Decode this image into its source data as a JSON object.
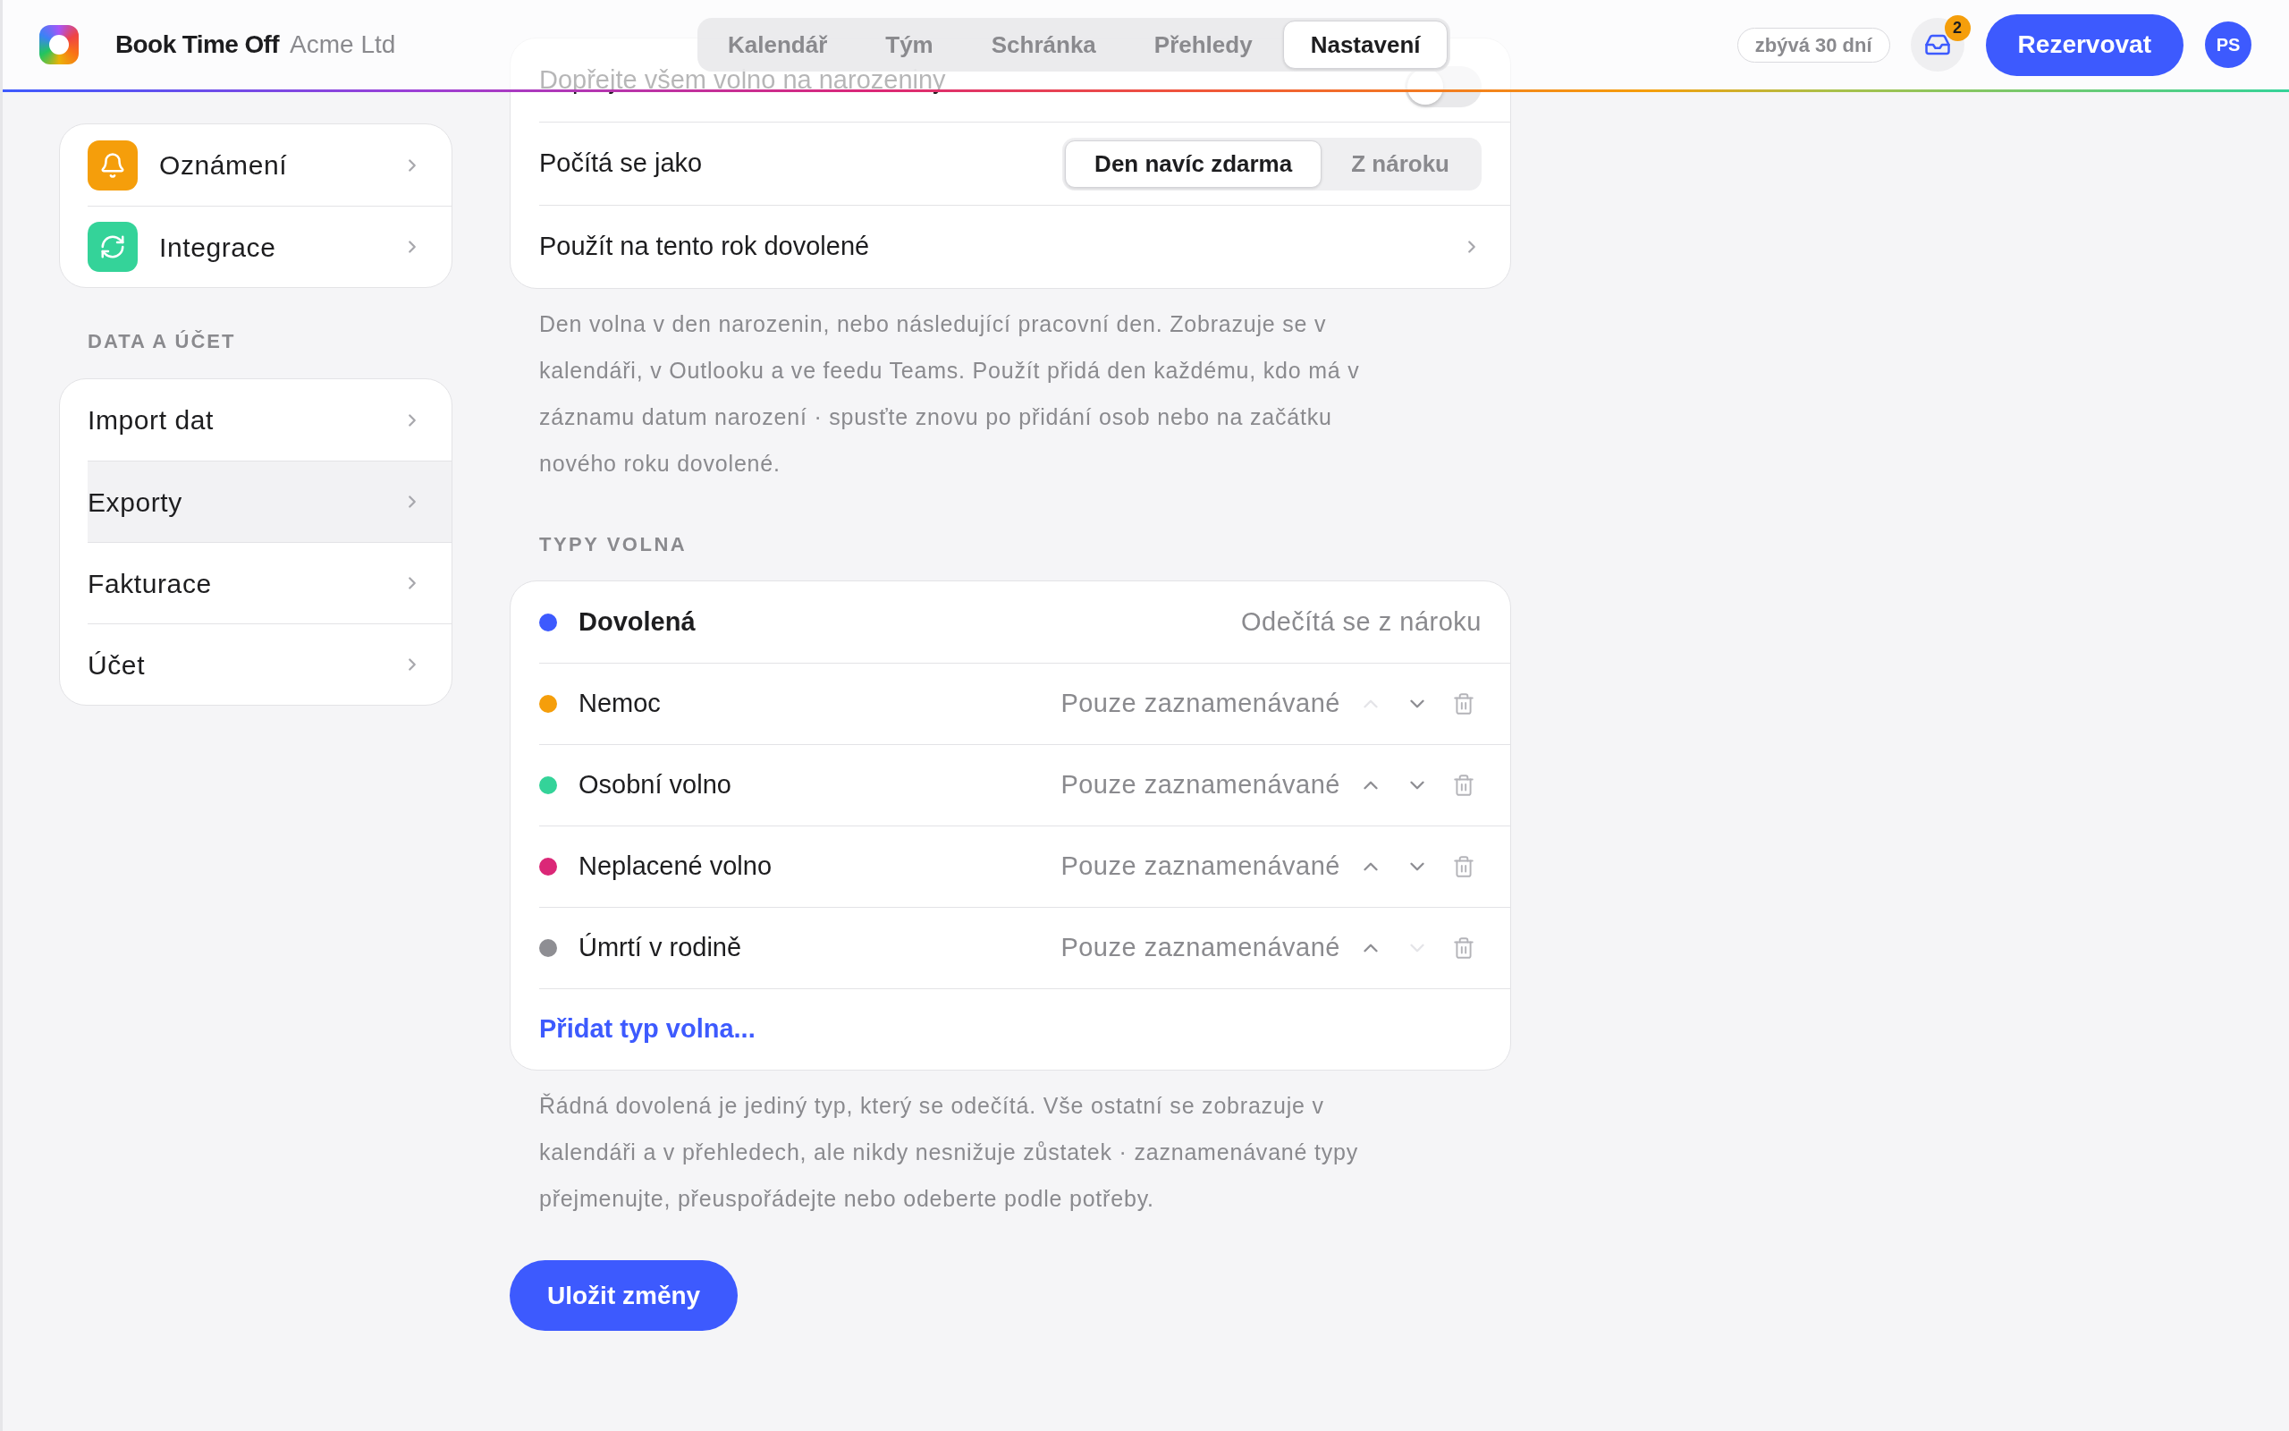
{
  "header": {
    "app_name": "Book Time Off",
    "org": "Acme Ltd",
    "tabs": [
      {
        "label": "Kalendář",
        "selected": false
      },
      {
        "label": "Tým",
        "selected": false
      },
      {
        "label": "Schránka",
        "selected": false
      },
      {
        "label": "Přehledy",
        "selected": false
      },
      {
        "label": "Nastavení",
        "selected": true
      }
    ],
    "remaining": "zbývá 30 dní",
    "inbox_badge": "2",
    "book_button": "Rezervovat",
    "avatar": "PS"
  },
  "sidebar": {
    "groups": [
      {
        "items": [
          {
            "label": "Oznámení",
            "color": "#f59e0b",
            "selected": false
          },
          {
            "label": "Integrace",
            "color": "#34d399",
            "selected": false
          }
        ]
      },
      {
        "heading": "DATA A ÚČET",
        "items": [
          {
            "label": "Import dat",
            "selected": false
          },
          {
            "label": "Exporty",
            "selected": true
          },
          {
            "label": "Fakturace",
            "selected": false
          },
          {
            "label": "Účet",
            "selected": false
          }
        ]
      }
    ]
  },
  "birthday": {
    "rows": [
      {
        "kind": "toggle",
        "label": "Dopřejte všem volno na narozeniny",
        "on": false
      },
      {
        "kind": "segmented",
        "label": "Počítá se jako",
        "options": [
          {
            "label": "Den navíc zdarma",
            "selected": true
          },
          {
            "label": "Z nároku",
            "selected": false
          }
        ]
      },
      {
        "kind": "link",
        "label": "Použít na tento rok dovolené"
      }
    ],
    "note": "Den volna v den narozenin, nebo následující pracovní den. Zobrazuje se v kalendáři, v Outlooku a ve feedu Teams. Použít přidá den každému, kdo má v záznamu datum narození · spusťte znovu po přidání osob nebo na začátku nového roku dovolené."
  },
  "leave_types": {
    "heading": "TYPY VOLNA",
    "types": [
      {
        "kind": "fixed",
        "name": "Dovolená",
        "color": "#3d5afe",
        "status": "Odečítá se z nároku"
      },
      {
        "kind": "editable",
        "name": "Nemoc",
        "color": "#f59e0b",
        "status": "Pouze zaznamenávané",
        "up_disabled": true,
        "down_disabled": false
      },
      {
        "kind": "editable",
        "name": "Osobní volno",
        "color": "#34d399",
        "status": "Pouze zaznamenávané",
        "up_disabled": false,
        "down_disabled": false
      },
      {
        "kind": "editable",
        "name": "Neplacené volno",
        "color": "#db2777",
        "status": "Pouze zaznamenávané",
        "up_disabled": false,
        "down_disabled": false
      },
      {
        "kind": "editable",
        "name": "Úmrtí v rodině",
        "color": "#8e8e93",
        "status": "Pouze zaznamenávané",
        "up_disabled": false,
        "down_disabled": true
      }
    ],
    "add_link": "Přidat typ volna...",
    "note": "Řádná dovolená je jediný typ, který se odečítá. Vše ostatní se zobrazuje v kalendáři a v přehledech, ale nikdy nesnižuje zůstatek · zaznamenávané typy přejmenujte, přeuspořádejte nebo odeberte podle potřeby."
  },
  "save_button": "Uložit změny"
}
